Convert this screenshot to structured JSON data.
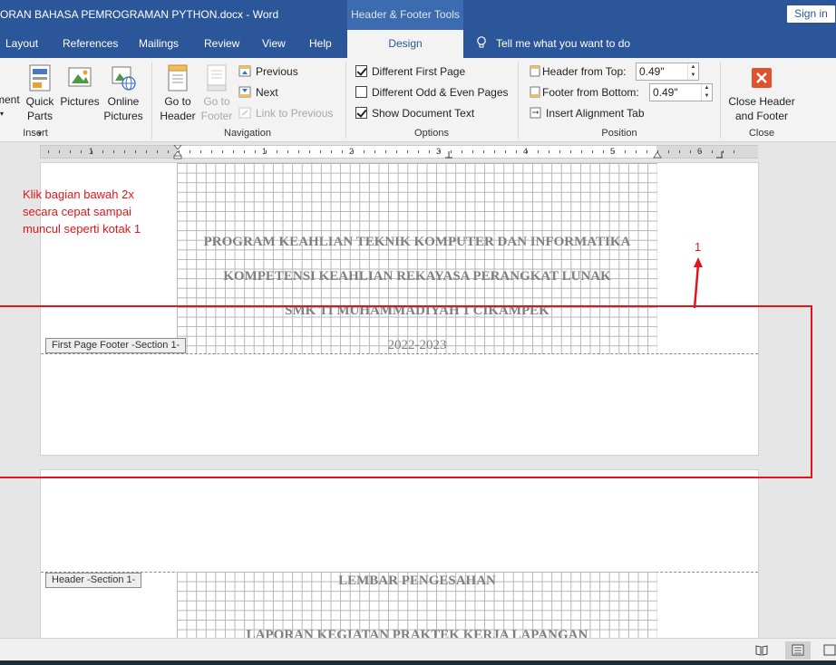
{
  "titlebar": {
    "title": "ORAN BAHASA PEMROGRAMAN PYTHON.docx  -  Word",
    "context_tab": "Header & Footer Tools",
    "signin": "Sign in"
  },
  "tabs": [
    {
      "label": "Layout"
    },
    {
      "label": "References"
    },
    {
      "label": "Mailings"
    },
    {
      "label": "Review"
    },
    {
      "label": "View"
    },
    {
      "label": "Help"
    },
    {
      "label": "Design",
      "active": true
    }
  ],
  "tellme": "Tell me what you want to do",
  "ribbon": {
    "insert": {
      "partial_label": "ment",
      "quick_parts": "Quick",
      "quick_parts2": "Parts",
      "pictures": "Pictures",
      "online": "Online",
      "online2": "Pictures",
      "group": "Insert"
    },
    "navigation": {
      "goto_header": "Go to",
      "goto_header2": "Header",
      "goto_footer": "Go to",
      "goto_footer2": "Footer",
      "previous": "Previous",
      "next": "Next",
      "link_previous": "Link to Previous",
      "group": "Navigation"
    },
    "options": {
      "diff_first": "Different First Page",
      "diff_first_checked": true,
      "diff_odd_even": "Different Odd & Even Pages",
      "diff_odd_even_checked": false,
      "show_doc_text": "Show Document Text",
      "show_doc_text_checked": true,
      "group": "Options"
    },
    "position": {
      "header_from_top": "Header from Top:",
      "header_value": "0.49\"",
      "footer_from_bottom": "Footer from Bottom:",
      "footer_value": "0.49\"",
      "alignment_tab": "Insert Alignment Tab",
      "group": "Position"
    },
    "close": {
      "label1": "Close Header",
      "label2": "and Footer",
      "group": "Close"
    }
  },
  "ruler_numbers": [
    "1",
    "1",
    "2",
    "3",
    "4",
    "5",
    "6"
  ],
  "page1": {
    "lines": [
      "PROGRAM KEAHLIAN TEKNIK KOMPUTER DAN INFORMATIKA",
      "KOMPETENSI KEAHLIAN REKAYASA PERANGKAT LUNAK",
      "SMK TI MUHAMMADIYAH 1 CIKAMPEK",
      "2022-2023"
    ],
    "footer_tag": "First Page Footer -Section 1-"
  },
  "page2": {
    "header_tag": "Header -Section 1-",
    "lines": [
      "LEMBAR PENGESAHAN",
      "LAPORAN KEGIATAN PRAKTEK KERJA LAPANGAN"
    ]
  },
  "annotation": {
    "line1": "Klik bagian bawah 2x",
    "line2": "secara cepat sampai",
    "line3": "muncul seperti kotak 1",
    "number": "1",
    "color": "#e0161b"
  }
}
